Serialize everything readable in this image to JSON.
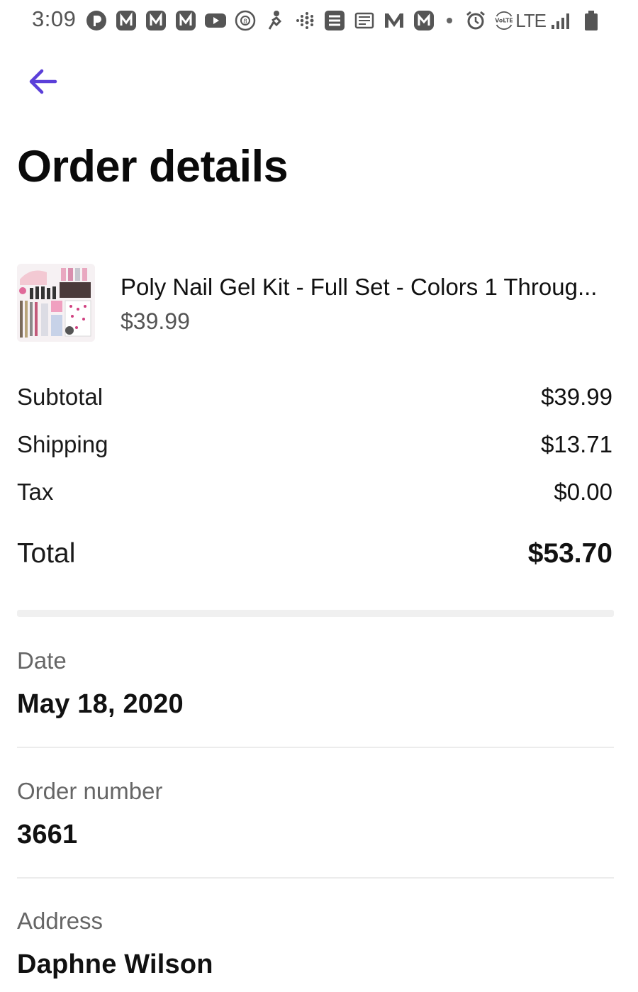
{
  "status_bar": {
    "time": "3:09",
    "network": "LTE",
    "volte": "VoLTE"
  },
  "header": {
    "back_icon": "arrow-left-icon",
    "accent_color": "#5b3fd9",
    "title": "Order details"
  },
  "product": {
    "name": "Poly Nail Gel Kit - Full Set - Colors 1 Throug...",
    "price": "$39.99",
    "thumbnail_icon": "product-thumbnail"
  },
  "summary": {
    "subtotal_label": "Subtotal",
    "subtotal_value": "$39.99",
    "shipping_label": "Shipping",
    "shipping_value": "$13.71",
    "tax_label": "Tax",
    "tax_value": "$0.00",
    "total_label": "Total",
    "total_value": "$53.70"
  },
  "details": {
    "date_label": "Date",
    "date_value": "May 18, 2020",
    "order_number_label": "Order number",
    "order_number_value": "3661",
    "address_label": "Address",
    "address_name": "Daphne Wilson"
  }
}
